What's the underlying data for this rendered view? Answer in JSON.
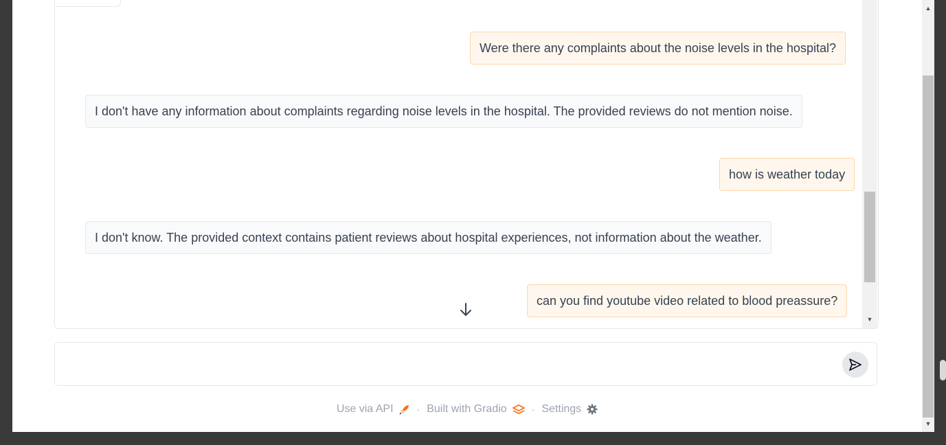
{
  "chat": {
    "messages": [
      {
        "role": "user",
        "text": "Were there any complaints about the noise levels in the hospital?"
      },
      {
        "role": "bot",
        "text": "I don't have any information about complaints regarding noise levels in the hospital. The provided reviews do not mention noise."
      },
      {
        "role": "user",
        "text": "how is weather today"
      },
      {
        "role": "bot",
        "text": "I don't know. The provided context contains patient reviews about hospital experiences, not information about the weather."
      },
      {
        "role": "user",
        "text": "can you find youtube video related to blood preassure?"
      }
    ]
  },
  "input": {
    "placeholder": "",
    "value": ""
  },
  "footer": {
    "api_label": "Use via API",
    "gradio_label": "Built with Gradio",
    "settings_label": "Settings",
    "separator": "·"
  },
  "icons": {
    "send": "send-icon",
    "scroll_down": "arrow-down-icon",
    "api": "rocket-icon",
    "gradio": "gradio-logo-icon",
    "settings": "gear-icon"
  },
  "colors": {
    "user_bubble_bg": "#fff7ed",
    "user_bubble_border": "#fed7aa",
    "bot_bubble_bg": "#f9fafb",
    "accent": "#f97316"
  }
}
